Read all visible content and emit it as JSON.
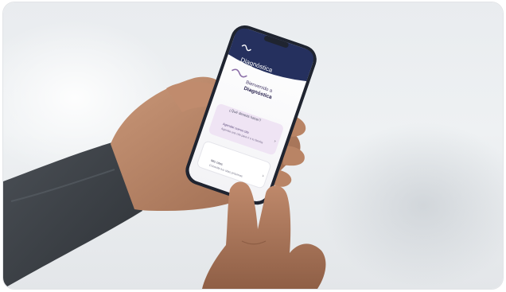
{
  "app": {
    "header_brand": "Diagnóstica",
    "welcome_line1": "Bienvenido a",
    "welcome_line2": "Diagnóstica",
    "question": "¿Qué deseas hacer?"
  },
  "cards": [
    {
      "title": "Agendar nueva cita",
      "subtitle": "Agenda una cita para ti o tu familia"
    },
    {
      "title": "Mis citas",
      "subtitle": "Consulta tus citas próximas"
    }
  ],
  "colors": {
    "phone_header": "#25305e",
    "card_highlight": "#efe4f4",
    "sleeve": "#3c4147"
  }
}
